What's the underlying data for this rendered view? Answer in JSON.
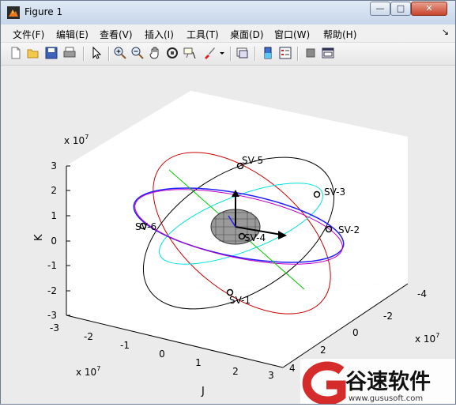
{
  "window": {
    "title": "Figure 1",
    "controls": {
      "minimize": "—",
      "maximize": "□",
      "close": "✕"
    }
  },
  "menubar": {
    "items": [
      "文件(F)",
      "编辑(E)",
      "查看(V)",
      "插入(I)",
      "工具(T)",
      "桌面(D)",
      "窗口(W)",
      "帮助(H)"
    ],
    "dock_arrow": "↘"
  },
  "toolbar": {
    "icons": [
      "new-figure-icon",
      "open-file-icon",
      "save-icon",
      "print-icon",
      "pointer-icon",
      "zoom-in-icon",
      "zoom-out-icon",
      "pan-icon",
      "rotate-3d-icon",
      "data-cursor-icon",
      "brush-icon",
      "link-plot-icon",
      "colorbar-icon",
      "legend-icon",
      "hide-plot-tools-icon",
      "show-plot-tools-icon"
    ]
  },
  "plot": {
    "exponent_label": "x 10",
    "exponent_power": "7",
    "zlabel": "K",
    "xlabel": "J",
    "z_ticks": [
      "3",
      "2",
      "1",
      "0",
      "-1",
      "-2",
      "-3"
    ],
    "j_ticks": [
      "-3",
      "-2",
      "-1",
      "0",
      "1",
      "2",
      "3"
    ],
    "i_ticks": [
      "-4",
      "-2",
      "0",
      "2",
      "4"
    ],
    "satellites": [
      "SV-1",
      "SV-2",
      "SV-3",
      "SV-4",
      "SV-5",
      "SV-6"
    ],
    "orbit_colors": {
      "black": "#000000",
      "red": "#cc0000",
      "cyan": "#00e0e0",
      "blue": "#2020ff",
      "magenta": "#c000c0",
      "green": "#00cc00"
    }
  },
  "watermark": {
    "brand": "谷速软件",
    "url": "www.gususoft.com"
  }
}
